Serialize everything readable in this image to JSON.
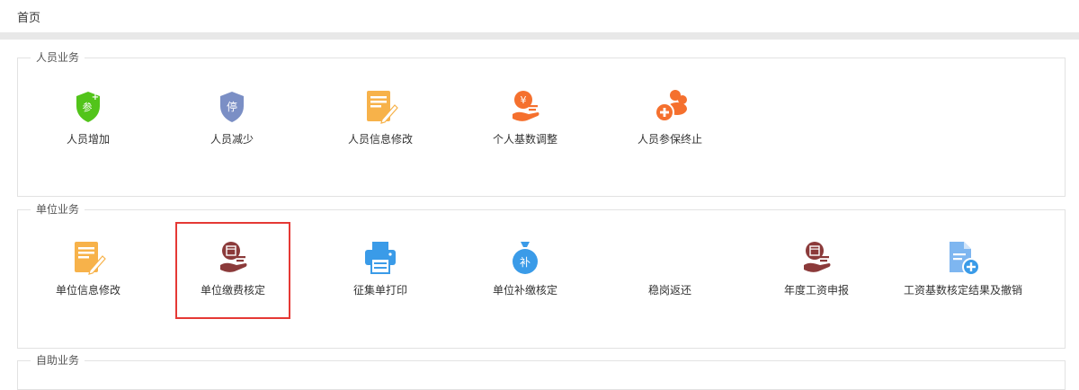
{
  "breadcrumb": {
    "home": "首页"
  },
  "sections": {
    "personnel": {
      "title": "人员业务",
      "items": [
        {
          "label": "人员增加",
          "icon_text": "参"
        },
        {
          "label": "人员减少",
          "icon_text": "停"
        },
        {
          "label": "人员信息修改"
        },
        {
          "label": "个人基数调整",
          "icon_text": "¥"
        },
        {
          "label": "人员参保终止"
        }
      ]
    },
    "unit": {
      "title": "单位业务",
      "items": [
        {
          "label": "单位信息修改"
        },
        {
          "label": "单位缴费核定"
        },
        {
          "label": "征集单打印"
        },
        {
          "label": "单位补缴核定",
          "icon_text": "补"
        },
        {
          "label": "稳岗返还"
        },
        {
          "label": "年度工资申报"
        },
        {
          "label": "工资基数核定结果及撤销"
        }
      ]
    },
    "selfservice": {
      "title": "自助业务"
    }
  },
  "colors": {
    "green": "#52c41a",
    "slate": "#7b8fc5",
    "amber": "#f7b24a",
    "orange": "#f5702e",
    "maroon": "#8b3a3a",
    "blue": "#3a9be8",
    "highlight": "#e53935"
  }
}
